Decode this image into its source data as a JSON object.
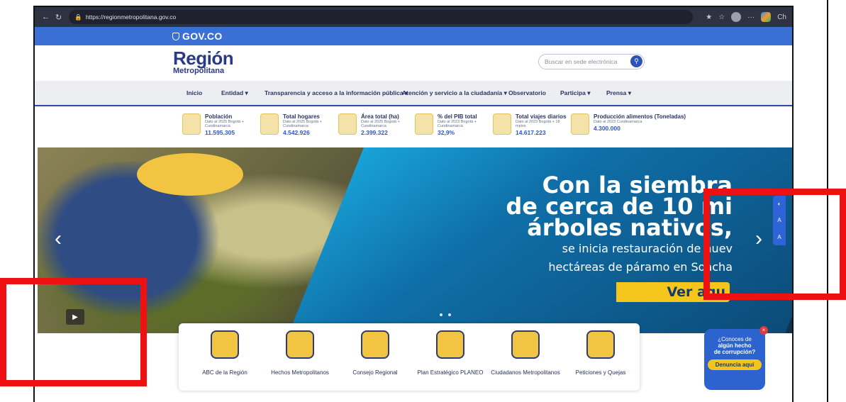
{
  "browser": {
    "url": "https://regionmetropolitana.gov.co",
    "partial_text": "Ch"
  },
  "gov_bar": {
    "label": "GOV.CO"
  },
  "logo": {
    "line1": "Región",
    "line2": "Metropolitana"
  },
  "search": {
    "placeholder": "Buscar en sede electrónica"
  },
  "nav": {
    "items": [
      {
        "label": "Inicio"
      },
      {
        "label": "Entidad ▾"
      },
      {
        "label": "Transparencia y acceso a la información pública ▾"
      },
      {
        "label": "Atención y servicio a la ciudadanía ▾"
      },
      {
        "label": "Observatorio"
      },
      {
        "label": "Participa ▾"
      },
      {
        "label": "Prensa ▾"
      }
    ]
  },
  "stats": [
    {
      "title": "Población",
      "subtitle": "Dato al 2025 Bogotá + Cundinamarca",
      "value": "11.595.305"
    },
    {
      "title": "Total hogares",
      "subtitle": "Dato al 2025 Bogotá + Cundinamarca",
      "value": "4.542.926"
    },
    {
      "title": "Área total (ha)",
      "subtitle": "Dato al 2025 Bogotá + Cundinamarca",
      "value": "2.399.322"
    },
    {
      "title": "% del PIB total",
      "subtitle": "Dato al 2023 Bogotá + Cundinamarca",
      "value": "32,9%"
    },
    {
      "title": "Total viajes diarios",
      "subtitle": "Dato al 2023 Bogotá + 18 mpios",
      "value": "14.617.223"
    },
    {
      "title": "Producción alimentos (Toneladas)",
      "subtitle": "Dato al 2023 Cundinamarca",
      "value": "4.300.000"
    }
  ],
  "hero": {
    "line1": "Con la siembra",
    "line2": "de cerca de 10 mi",
    "line3": "árboles nativos,",
    "line4": "se inicia restauración de nuev",
    "line5": "hectáreas de páramo en Soacha",
    "cta": "Ver aqu"
  },
  "quick_links": [
    {
      "label": "ABC de la Región"
    },
    {
      "label": "Hechos Metropolitanos"
    },
    {
      "label": "Consejo Regional"
    },
    {
      "label": "Plan Estratégico PLANEO"
    },
    {
      "label": "Ciudadanos Metropolitanos"
    },
    {
      "label": "Peticiones y Quejas"
    }
  ],
  "widget": {
    "line1": "¿Conoces de",
    "line2": "algún hecho",
    "line3": "de corrupción?",
    "button": "Denuncia aquí"
  },
  "colors": {
    "gov_blue": "#3a6fd6",
    "brand_navy": "#2a3a88",
    "accent_yellow": "#f4c51a",
    "annotation_red": "#ee1111"
  }
}
